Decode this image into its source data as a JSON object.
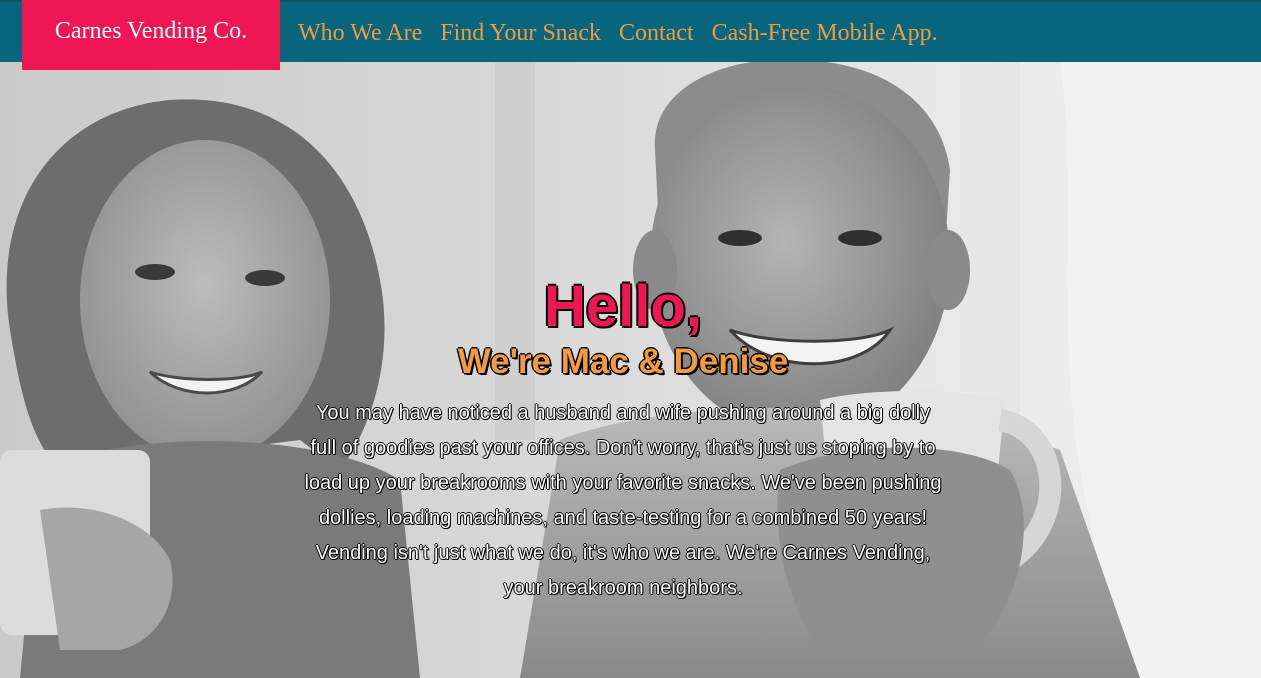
{
  "nav": {
    "brand": "Carnes Vending Co.",
    "links": [
      {
        "label": "Who We Are"
      },
      {
        "label": "Find Your Snack"
      },
      {
        "label": "Contact"
      },
      {
        "label": "Cash-Free Mobile App."
      }
    ]
  },
  "hero": {
    "greeting": "Hello,",
    "subtitle": "We're Mac & Denise",
    "body": "You may have noticed a husband and wife pushing around a big dolly full of goodies past your offices. Don't worry, that's just us stoping by to load up your breakrooms with your favorite snacks. We've been pushing dollies, loading machines, and taste-testing for a combined 50 years! Vending isn't just what we do, it's who we are. We're Carnes Vending, your breakroom neighbors."
  },
  "colors": {
    "nav_bg": "#07657d",
    "brand_bg": "#ee1653",
    "link": "#f39a3f",
    "greeting": "#ee1653",
    "subtitle": "#f39a3f",
    "body_text": "#ffffff"
  }
}
